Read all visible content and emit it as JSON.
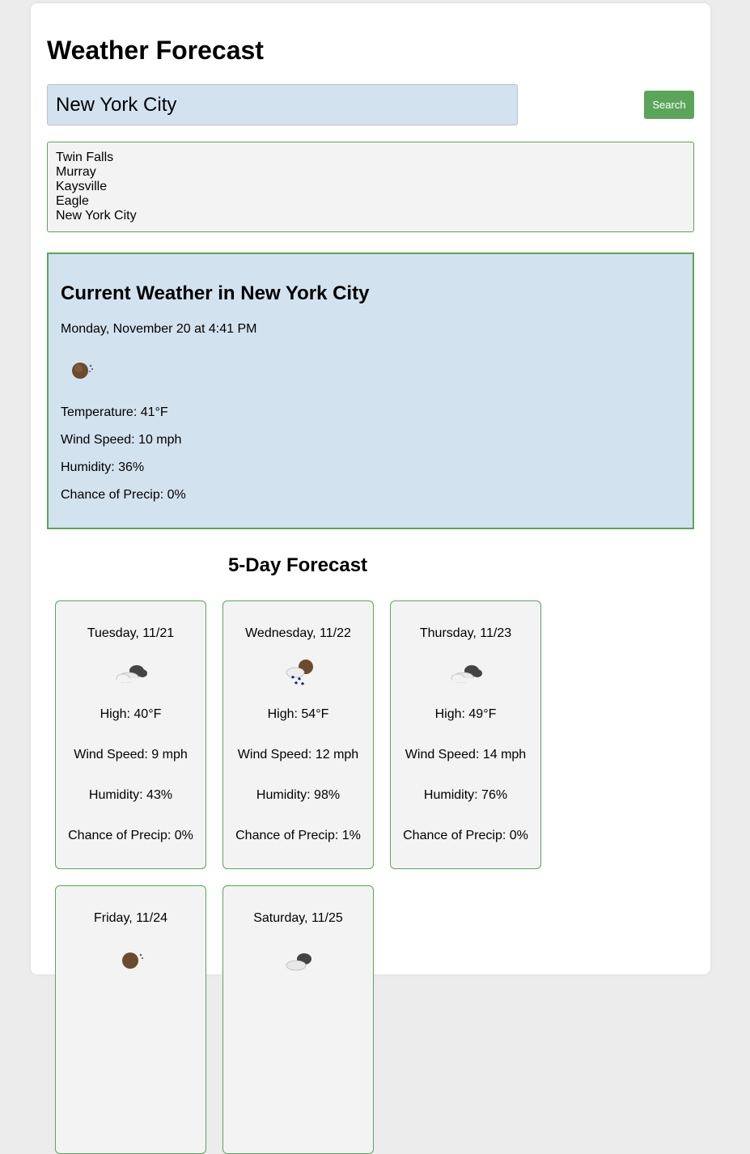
{
  "app": {
    "title": "Weather Forecast"
  },
  "search": {
    "value": "New York City",
    "button_label": "Search"
  },
  "history": {
    "items": [
      "Twin Falls",
      "Murray",
      "Kaysville",
      "Eagle",
      "New York City"
    ]
  },
  "current": {
    "title": "Current Weather in New York City",
    "date": "Monday, November 20 at 4:41 PM",
    "icon": "moon-cloud-icon",
    "temperature": "Temperature: 41°F",
    "wind": "Wind Speed: 10 mph",
    "humidity": "Humidity: 36%",
    "precip": "Chance of Precip: 0%"
  },
  "forecast": {
    "title": "5-Day Forecast",
    "days": [
      {
        "date": "Tuesday, 11/21",
        "icon": "cloud-icon",
        "high": "High: 40°F",
        "wind": "Wind Speed: 9 mph",
        "humidity": "Humidity: 43%",
        "precip": "Chance of Precip: 0%"
      },
      {
        "date": "Wednesday, 11/22",
        "icon": "rain-cloud-moon-icon",
        "high": "High: 54°F",
        "wind": "Wind Speed: 12 mph",
        "humidity": "Humidity: 98%",
        "precip": "Chance of Precip: 1%"
      },
      {
        "date": "Thursday, 11/23",
        "icon": "cloud-icon",
        "high": "High: 49°F",
        "wind": "Wind Speed: 14 mph",
        "humidity": "Humidity: 76%",
        "precip": "Chance of Precip: 0%"
      },
      {
        "date": "Friday, 11/24",
        "icon": "moon-cloud-icon",
        "high": "",
        "wind": "",
        "humidity": "",
        "precip": ""
      },
      {
        "date": "Saturday, 11/25",
        "icon": "cloud-icon",
        "high": "",
        "wind": "",
        "humidity": "",
        "precip": ""
      }
    ]
  },
  "colors": {
    "accent_green": "#5ba55b",
    "panel_blue": "#d3e2ef",
    "card_gray": "#f3f3f3"
  }
}
